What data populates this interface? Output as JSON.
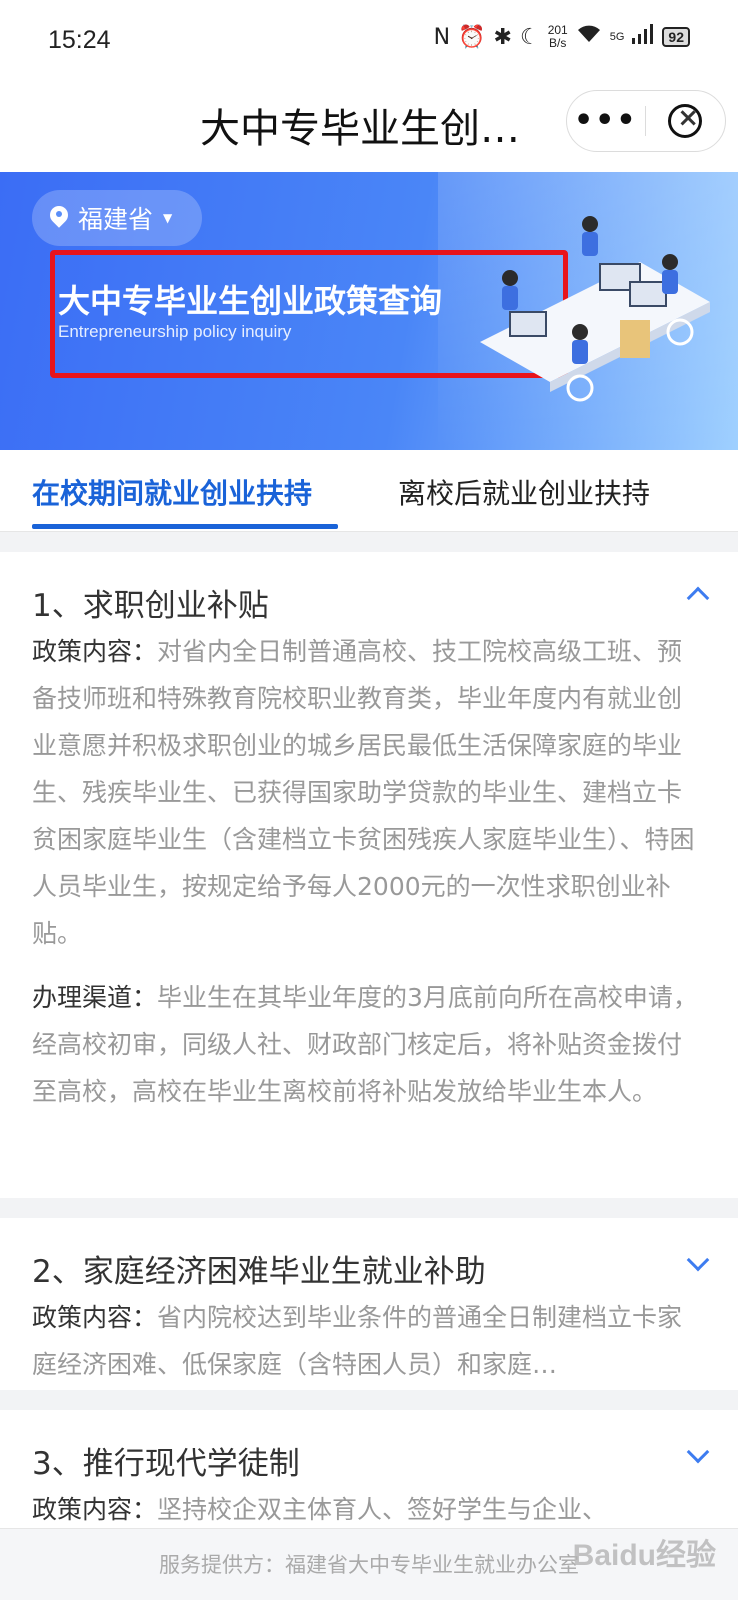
{
  "status_bar": {
    "time": "15:24",
    "net_speed_value": "201",
    "net_speed_unit": "B/s",
    "signal_label": "5G",
    "battery": "92",
    "icons": [
      "nfc-icon",
      "alarm-icon",
      "bluetooth-icon",
      "moon-icon",
      "wifi-icon",
      "signal-icon",
      "battery-icon"
    ]
  },
  "header": {
    "title": "大中专毕业生创…"
  },
  "banner": {
    "region": "福建省",
    "title": "大中专毕业生创业政策查询",
    "subtitle": "Entrepreneurship policy inquiry"
  },
  "tabs": [
    {
      "label": "在校期间就业创业扶持",
      "active": true
    },
    {
      "label": "离校后就业创业扶持",
      "active": false
    }
  ],
  "items": [
    {
      "title": "1、求职创业补贴",
      "expanded": true,
      "content_label": "政策内容：",
      "content": "对省内全日制普通高校、技工院校高级工班、预备技师班和特殊教育院校职业教育类，毕业年度内有就业创业意愿并积极求职创业的城乡居民最低生活保障家庭的毕业生、残疾毕业生、已获得国家助学贷款的毕业生、建档立卡贫困家庭毕业生（含建档立卡贫困残疾人家庭毕业生）、特困人员毕业生，按规定给予每人2000元的一次性求职创业补贴。",
      "channel_label": "办理渠道：",
      "channel": "毕业生在其毕业年度的3月底前向所在高校申请，经高校初审，同级人社、财政部门核定后，将补贴资金拨付至高校，高校在毕业生离校前将补贴发放给毕业生本人。"
    },
    {
      "title": "2、家庭经济困难毕业生就业补助",
      "expanded": false,
      "content_label": "政策内容：",
      "content": "省内院校达到毕业条件的普通全日制建档立卡家庭经济困难、低保家庭（含特困人员）和家庭…"
    },
    {
      "title": "3、推行现代学徒制",
      "expanded": false,
      "content_label": "政策内容：",
      "content": "坚持校企双主体育人、签好学生与企业、"
    }
  ],
  "footer": {
    "text": "服务提供方：福建省大中专毕业生就业办公室"
  },
  "watermark": "Baidu经验",
  "colors": {
    "accent": "#1a63d8",
    "highlight_box": "#e8141b",
    "banner_start": "#3b6df5"
  }
}
